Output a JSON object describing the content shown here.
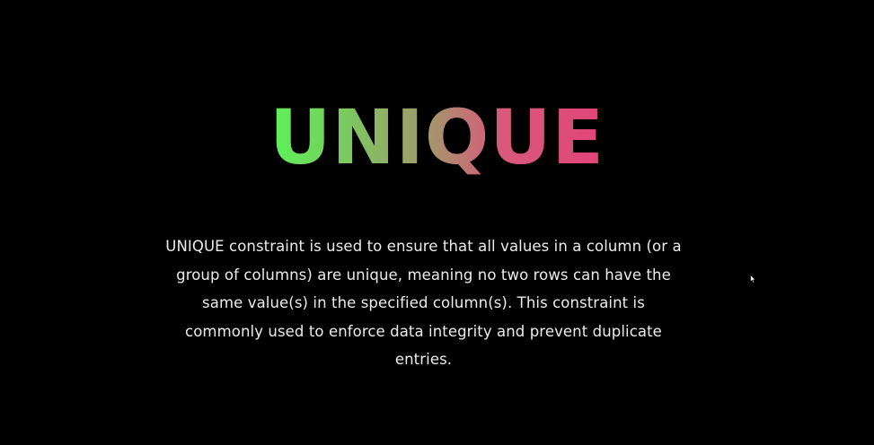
{
  "slide": {
    "title": "UNIQUE",
    "description": "UNIQUE constraint is used to ensure that all values in a column (or a group of columns) are unique, meaning no two rows can have the same value(s) in the specified column(s). This constraint is commonly used to enforce data integrity and prevent duplicate entries."
  },
  "colors": {
    "background": "#000000",
    "title_gradient_start": "#5cf25a",
    "title_gradient_mid": "#a4966c",
    "title_gradient_end": "#e1447a",
    "description_text": "#ececec"
  },
  "icons": {
    "cursor": "mouse-pointer-icon"
  }
}
